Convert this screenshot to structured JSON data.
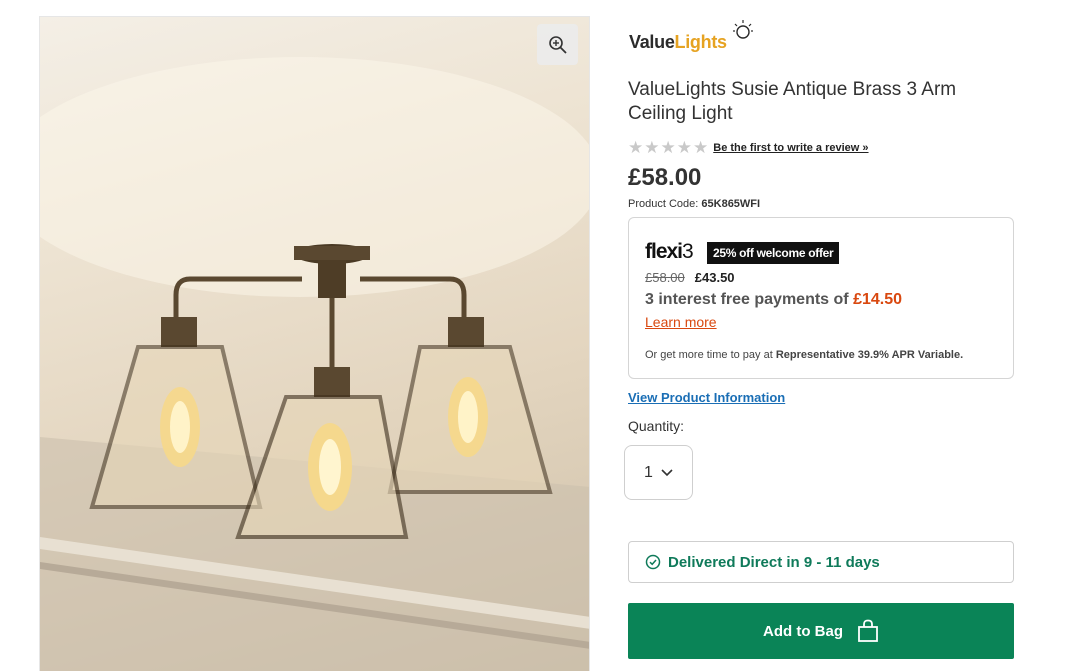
{
  "product": {
    "image_alt": "ValueLights Susie Antique Brass 3 Arm Ceiling Light",
    "zoom_icon": "zoom-in-icon",
    "brand": {
      "part1": "Value",
      "part2": "Lights"
    },
    "title": "ValueLights Susie Antique Brass 3 Arm Ceiling Light",
    "rating": {
      "stars": 5,
      "filled": 0,
      "review_link": "Be the first to write a review »"
    },
    "price": "£58.00",
    "code_label": "Product Code:",
    "code": "65K865WFI"
  },
  "flexi": {
    "logo": "flexi",
    "logo_num": "3",
    "badge": "25% off welcome offer",
    "old_price": "£58.00",
    "new_price": "£43.50",
    "installments_text": "3 interest free payments of",
    "installment_amount": "£14.50",
    "learn_more": "Learn more",
    "apr_prefix": "Or get more time to pay at",
    "apr_bold": "Representative 39.9% APR Variable."
  },
  "links": {
    "view_info": "View Product Information"
  },
  "quantity": {
    "label": "Quantity:",
    "value": "1"
  },
  "delivery": {
    "text": "Delivered Direct in 9 - 11 days",
    "icon": "check-circle-icon"
  },
  "cta": {
    "label": "Add to Bag",
    "icon": "shopping-bag-icon"
  },
  "colors": {
    "green": "#0a8457",
    "orange": "#d9480f",
    "link_blue": "#1a6eb5",
    "brand_yellow": "#e6a322"
  }
}
